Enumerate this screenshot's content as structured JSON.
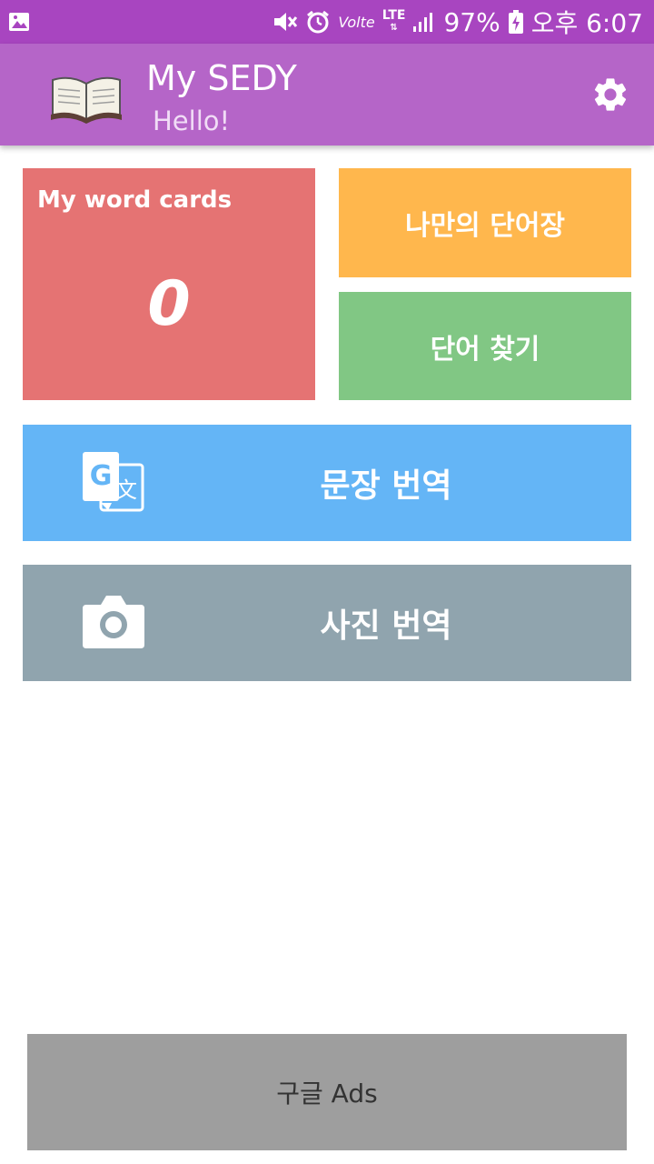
{
  "status_bar": {
    "battery": "97%",
    "time": "오후 6:07",
    "network": "LTE",
    "volte": "Volte"
  },
  "app_bar": {
    "title": "My SEDY",
    "subtitle": "Hello!",
    "logo_icon": "open-book-icon",
    "settings_icon": "gear-icon"
  },
  "tiles": {
    "word_cards": {
      "label": "My word cards",
      "count": "0"
    },
    "my_vocab": {
      "label": "나만의 단어장"
    },
    "find_word": {
      "label": "단어 찾기"
    },
    "sentence_translate": {
      "label": "문장 번역",
      "icon": "google-translate-icon"
    },
    "photo_translate": {
      "label": "사진 번역",
      "icon": "camera-icon"
    }
  },
  "ads": {
    "label": "구글 Ads"
  },
  "colors": {
    "status_bar": "#a845c0",
    "app_bar": "#b565c8",
    "word_cards": "#e57373",
    "my_vocab": "#ffb74d",
    "find_word": "#81c784",
    "sentence_translate": "#64b5f6",
    "photo_translate": "#90a4ae",
    "ads": "#9e9e9e"
  }
}
